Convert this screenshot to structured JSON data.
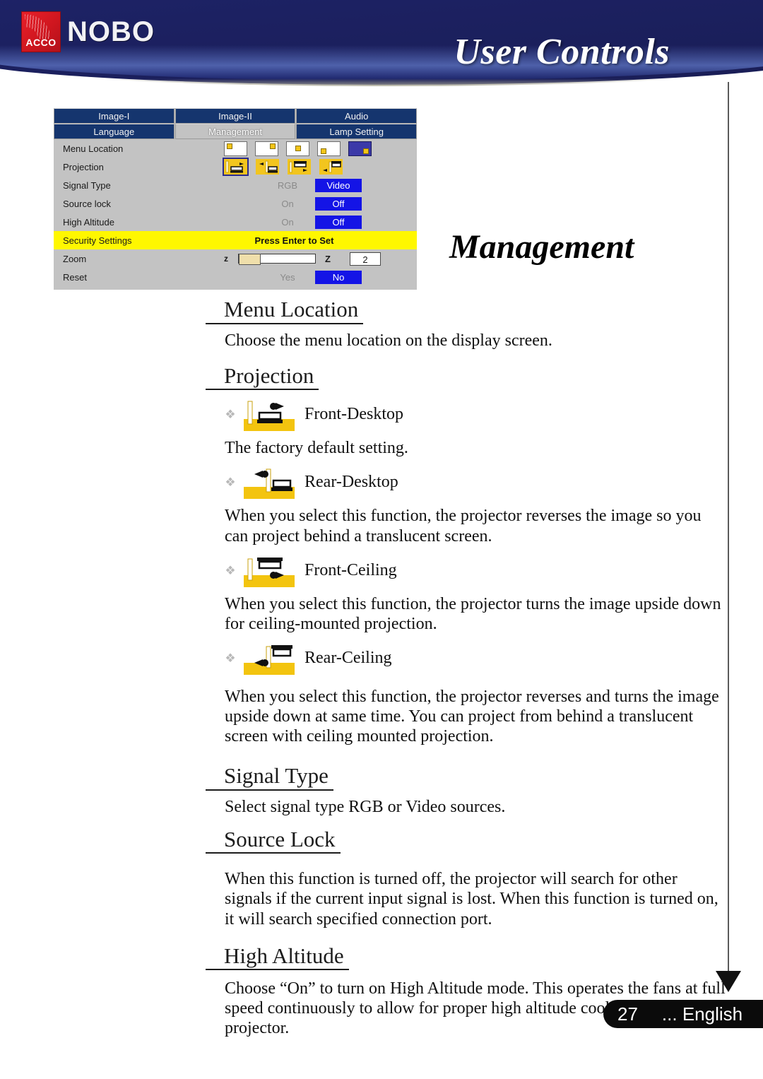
{
  "header": {
    "brand_primary": "ACCO",
    "brand_secondary": "NOBO",
    "title": "User Controls",
    "bg_color": "#1d2265"
  },
  "osd": {
    "tabs_row1": [
      "Image-I",
      "Image-II",
      "Audio"
    ],
    "tabs_row2": [
      "Language",
      "Management",
      "Lamp Setting"
    ],
    "active_tab": "Management",
    "rows": [
      {
        "label": "Menu Location",
        "type": "icons5"
      },
      {
        "label": "Projection",
        "type": "icons4"
      },
      {
        "label": "Signal Type",
        "type": "toggle",
        "option_dim": "RGB",
        "option_selected": "Video"
      },
      {
        "label": "Source lock",
        "type": "toggle",
        "option_dim": "On",
        "option_selected": "Off"
      },
      {
        "label": "High Altitude",
        "type": "toggle",
        "option_dim": "On",
        "option_selected": "Off"
      },
      {
        "label": "Security Settings",
        "type": "highlight",
        "action": "Press Enter to Set"
      },
      {
        "label": "Zoom",
        "type": "slider",
        "left_marker": "z",
        "right_marker": "Z",
        "value": "2"
      },
      {
        "label": "Reset",
        "type": "toggle",
        "option_dim": "Yes",
        "option_selected": "No"
      }
    ]
  },
  "page_title": "Management",
  "sections": [
    {
      "heading": "Menu Location",
      "paragraphs": [
        "Choose the menu location on the display screen."
      ],
      "bullets": []
    },
    {
      "heading": "Projection",
      "paragraphs": [],
      "bullets": [
        {
          "icon": "front-desktop-icon",
          "label": "Front-Desktop",
          "desc": "The factory default setting."
        },
        {
          "icon": "rear-desktop-icon",
          "label": "Rear-Desktop",
          "desc": "When you select this function, the projector reverses the image so you can project behind a translucent screen."
        },
        {
          "icon": "front-ceiling-icon",
          "label": "Front-Ceiling",
          "desc": "When you select this function, the projector turns the image upside down for ceiling-mounted projection."
        },
        {
          "icon": "rear-ceiling-icon",
          "label": "Rear-Ceiling",
          "desc": "When you select this function, the projector reverses and turns the image upside down at same time. You can project from behind a translucent screen with ceiling mounted projection."
        }
      ]
    },
    {
      "heading": "Signal Type",
      "paragraphs": [
        "Select signal type RGB or Video sources."
      ],
      "bullets": []
    },
    {
      "heading": "Source Lock",
      "paragraphs": [
        "When this function is turned off, the projector will search for other signals if the current input signal is lost. When this function is turned on, it will search specified connection port."
      ],
      "bullets": []
    },
    {
      "heading": "High Altitude",
      "paragraphs": [
        "Choose “On” to turn on High Altitude mode. This operates the fans at full speed continuously to allow for proper high altitude cooling of the projector."
      ],
      "bullets": []
    }
  ],
  "footer": {
    "page_number": "27",
    "language": "... English"
  }
}
